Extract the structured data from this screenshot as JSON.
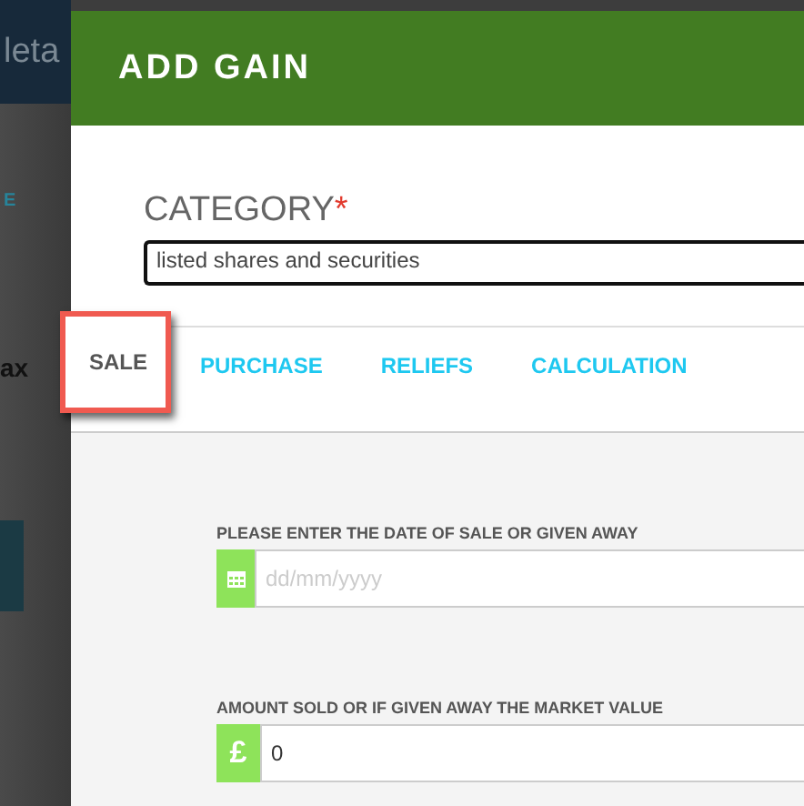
{
  "background_page": {
    "brand_fragment": "leta",
    "link_fragment": "E",
    "heading_fragment": "ax"
  },
  "dialog": {
    "title": "ADD GAIN",
    "category": {
      "label": "CATEGORY",
      "required_mark": "*",
      "value": "listed shares and securities"
    },
    "tabs": [
      {
        "label": "SALE",
        "selected": true,
        "highlighted": true
      },
      {
        "label": "PURCHASE",
        "selected": false,
        "highlighted": false
      },
      {
        "label": "RELIEFS",
        "selected": false,
        "highlighted": false
      },
      {
        "label": "CALCULATION",
        "selected": false,
        "highlighted": false
      }
    ],
    "fields": [
      {
        "kind": "date",
        "label": "PLEASE ENTER THE DATE OF SALE OR GIVEN AWAY",
        "placeholder": "dd/mm/yyyy"
      },
      {
        "kind": "currency",
        "label": "AMOUNT SOLD OR IF GIVEN AWAY THE MARKET VALUE",
        "prefix": "£",
        "value": "0"
      }
    ]
  }
}
